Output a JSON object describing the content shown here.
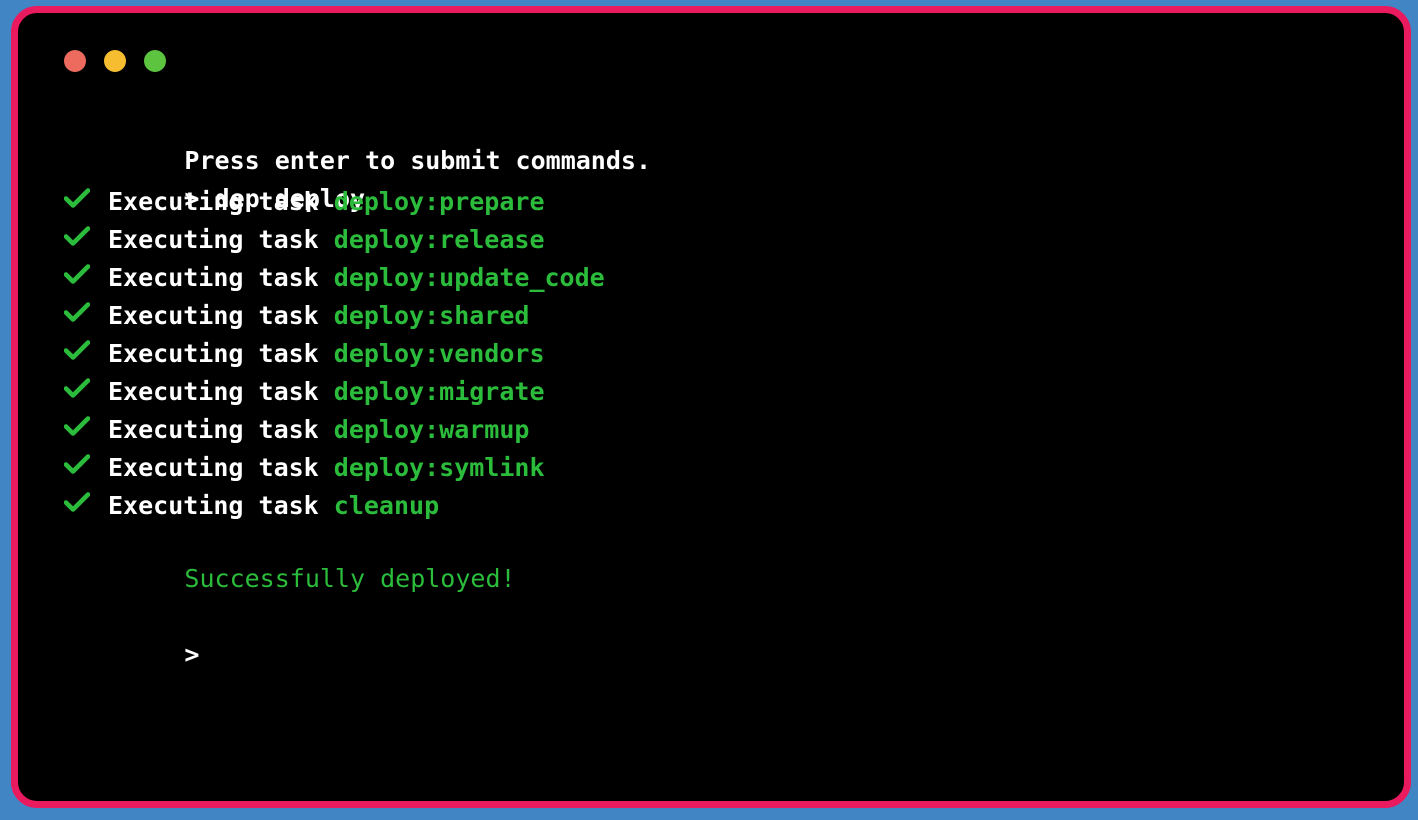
{
  "window": {
    "name": "terminal-window",
    "background_color": "#000000",
    "border_color": "#ea1a5f",
    "desktop_color": "#4285c4",
    "controls": [
      {
        "name": "close",
        "color": "#ed6a5e"
      },
      {
        "name": "minimize",
        "color": "#f5bd2f"
      },
      {
        "name": "maximize",
        "color": "#5cc43f"
      }
    ]
  },
  "console": {
    "text_color": "#ffffff",
    "accent_color": "#2cbc3c",
    "notice": "Press enter to submit commands.",
    "prompt_symbol": ">",
    "command": "dep deploy",
    "task_label": "Executing task",
    "check_icon": "check-mark-icon",
    "tasks": [
      "deploy:prepare",
      "deploy:release",
      "deploy:update_code",
      "deploy:shared",
      "deploy:vendors",
      "deploy:migrate",
      "deploy:warmup",
      "deploy:symlink",
      "cleanup"
    ],
    "success_message": "Successfully deployed!",
    "final_prompt": ">",
    "input_value": ""
  }
}
